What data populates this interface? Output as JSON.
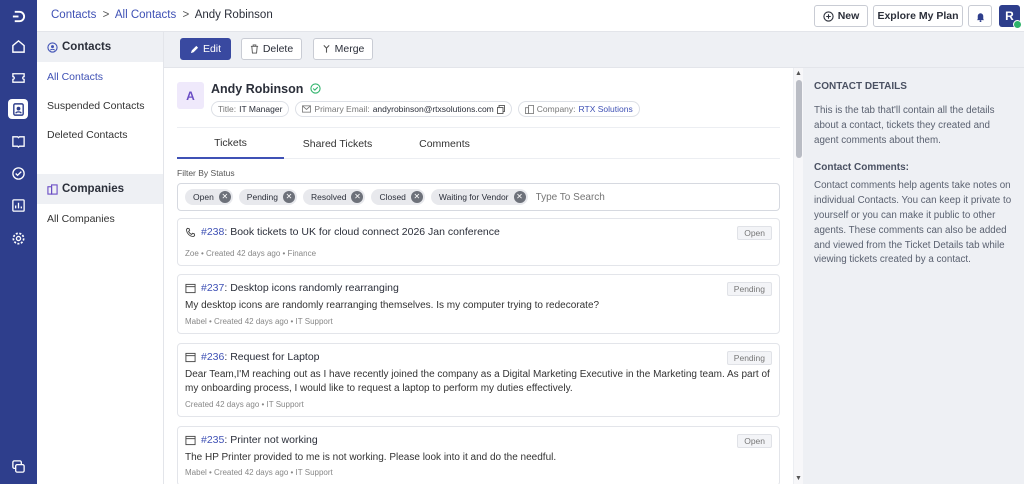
{
  "breadcrumb": {
    "root": "Contacts",
    "sep1": ">",
    "parent": "All Contacts",
    "sep2": ">",
    "current": "Andy Robinson"
  },
  "header": {
    "new_label": "New",
    "plan_label": "Explore My Plan",
    "avatar_initial": "R"
  },
  "actions": {
    "edit": "Edit",
    "delete": "Delete",
    "merge": "Merge"
  },
  "sidebar": {
    "contacts_title": "Contacts",
    "contact_items": [
      "All Contacts",
      "Suspended Contacts",
      "Deleted Contacts"
    ],
    "companies_title": "Companies",
    "company_items": [
      "All Companies"
    ]
  },
  "contact": {
    "initial": "A",
    "name": "Andy Robinson",
    "title_label": "Title:",
    "title_value": "IT Manager",
    "email_label": "Primary Email:",
    "email_value": "andyrobinson@rtxsolutions.com",
    "company_label": "Company:",
    "company_value": "RTX Solutions"
  },
  "tabs": [
    "Tickets",
    "Shared Tickets",
    "Comments"
  ],
  "filter": {
    "label": "Filter By Status",
    "chips": [
      "Open",
      "Pending",
      "Resolved",
      "Closed",
      "Waiting for Vendor"
    ],
    "placeholder": "Type To Search"
  },
  "tickets": [
    {
      "icon": "phone-icon",
      "number": "#238",
      "title": ": Book tickets to UK for cloud connect 2026 Jan conference",
      "status": "Open",
      "description": "",
      "meta": "Zoe  •  Created 42 days ago  •  Finance"
    },
    {
      "icon": "browser-icon",
      "number": "#237",
      "title": ": Desktop icons randomly rearranging",
      "status": "Pending",
      "description": "My desktop icons are randomly rearranging themselves. Is my computer trying to redecorate?",
      "meta": "Mabel  •  Created 42 days ago  •  IT Support"
    },
    {
      "icon": "browser-icon",
      "number": "#236",
      "title": ": Request for Laptop",
      "status": "Pending",
      "description": "Dear Team,I'M reaching out as I have recently joined the company as a Digital Marketing Executive in the Marketing team. As part of my onboarding process, I would like to request a laptop to perform my duties effectively.",
      "meta": "Created 42 days ago  •  IT Support"
    },
    {
      "icon": "browser-icon",
      "number": "#235",
      "title": ": Printer not working",
      "status": "Open",
      "description": "The HP Printer provided to me is not working. Please look into it and do the needful.",
      "meta": "Mabel  •  Created 42 days ago  •  IT Support"
    }
  ],
  "details_panel": {
    "title": "CONTACT DETAILS",
    "intro": "This is the tab that'll contain all the details about a contact, tickets they created and agent comments about them.",
    "comments_title": "Contact Comments:",
    "comments_text": "Contact comments help agents take notes on individual Contacts. You can keep it private to yourself or you can make it public to other agents. These comments can also be added and viewed from the Ticket Details tab while viewing tickets created by a contact."
  },
  "colors": {
    "rail": "#2e3e8c",
    "accent": "#3f51b5",
    "primary_button": "#3949a0",
    "online": "#2fb36b"
  }
}
